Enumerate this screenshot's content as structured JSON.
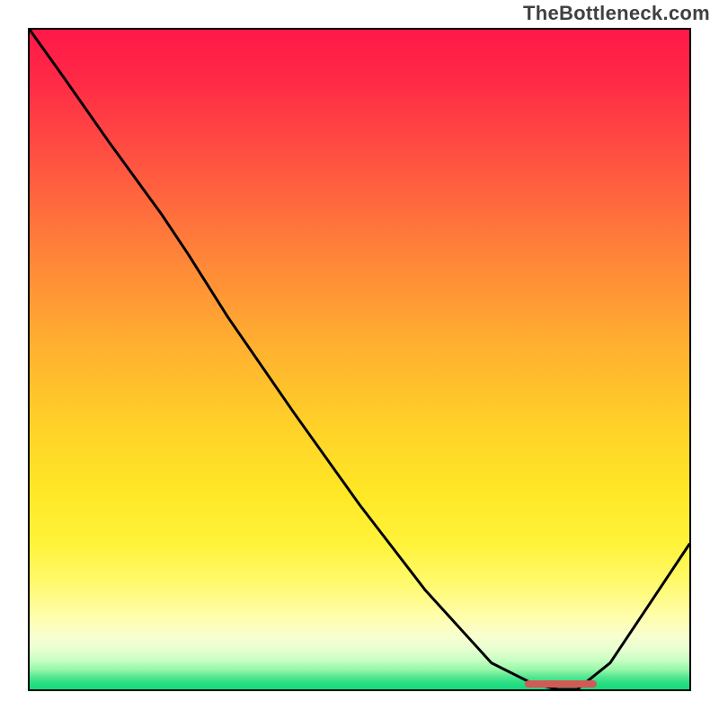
{
  "watermark": "TheBottleneck.com",
  "chart_data": {
    "type": "line",
    "title": "",
    "xlabel": "",
    "ylabel": "",
    "xlim": [
      0,
      100
    ],
    "ylim": [
      0,
      100
    ],
    "grid": false,
    "legend": false,
    "background_gradient": {
      "direction": "vertical",
      "stops": [
        {
          "pos": 0,
          "color": "#ff1848"
        },
        {
          "pos": 50,
          "color": "#ffc528"
        },
        {
          "pos": 85,
          "color": "#fffa80"
        },
        {
          "pos": 100,
          "color": "#12d97c"
        }
      ]
    },
    "series": [
      {
        "name": "bottleneck-curve",
        "color": "#000000",
        "x": [
          0,
          5,
          12,
          20,
          24,
          30,
          40,
          50,
          60,
          70,
          76,
          80,
          83,
          88,
          94,
          100
        ],
        "y": [
          100,
          93,
          83,
          72,
          66,
          56.5,
          42,
          28,
          15,
          4,
          1,
          0,
          0,
          4,
          13,
          22
        ]
      }
    ],
    "annotations": [
      {
        "name": "optimal-zone-marker",
        "type": "segment",
        "color": "#d15a56",
        "y": 0.8,
        "x_start": 75,
        "x_end": 86
      }
    ]
  }
}
